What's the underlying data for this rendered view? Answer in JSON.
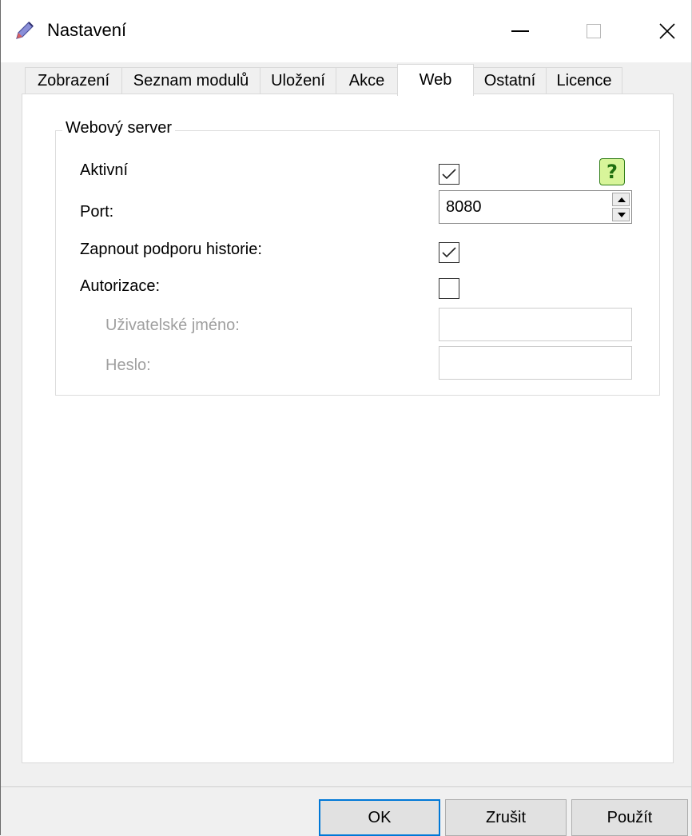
{
  "window": {
    "title": "Nastavení",
    "app_icon": "pen-icon",
    "controls": {
      "minimize": "minimize-icon",
      "maximize": "maximize-icon",
      "close": "close-icon"
    }
  },
  "tabs": [
    {
      "label": "Zobrazení"
    },
    {
      "label": "Seznam modulů"
    },
    {
      "label": "Uložení"
    },
    {
      "label": "Akce"
    },
    {
      "label": "Web",
      "active": true
    },
    {
      "label": "Ostatní"
    },
    {
      "label": "Licence"
    }
  ],
  "web_server": {
    "group_title": "Webový server",
    "active": {
      "label": "Aktivní",
      "checked": true
    },
    "help_icon": "question-mark-icon",
    "help_glyph": "?",
    "port": {
      "label": "Port:",
      "value": "8080"
    },
    "history": {
      "label": "Zapnout podporu historie:",
      "checked": true
    },
    "authorization": {
      "label": "Autorizace:",
      "checked": false
    },
    "username": {
      "label": "Uživatelské jméno:",
      "value": ""
    },
    "password": {
      "label": "Heslo:",
      "value": ""
    }
  },
  "buttons": {
    "ok": "OK",
    "cancel": "Zrušit",
    "apply": "Použít"
  },
  "colors": {
    "accent": "#0078d7",
    "help_bg": "#d8f59a",
    "help_fg": "#1f6f10"
  }
}
